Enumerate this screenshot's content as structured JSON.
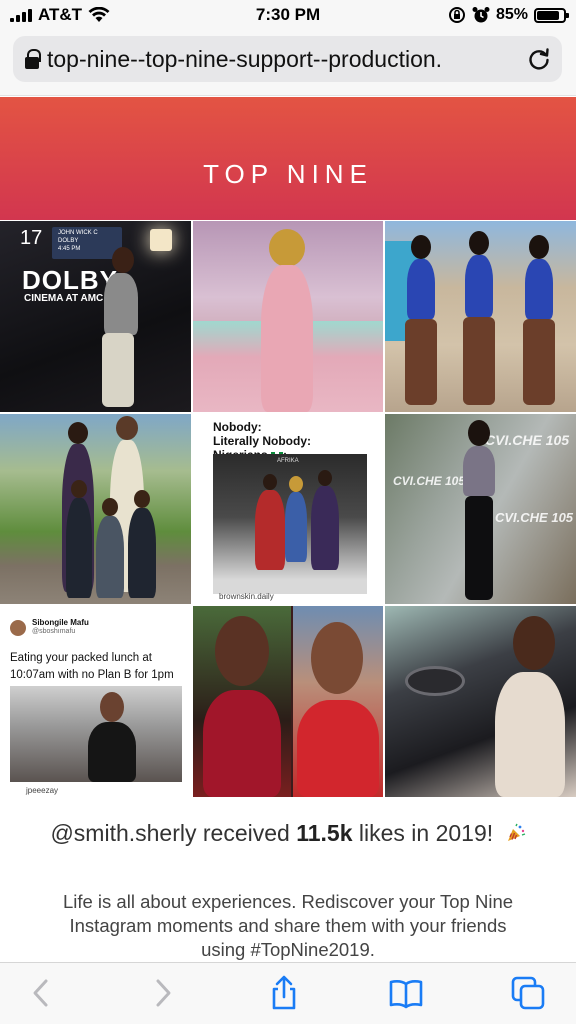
{
  "status_bar": {
    "carrier": "AT&T",
    "time": "7:30 PM",
    "battery_percent": "85%",
    "battery_level": 0.85,
    "icons": [
      "signal-icon",
      "wifi-icon",
      "orientation-lock-icon",
      "alarm-icon",
      "battery-icon"
    ]
  },
  "browser": {
    "url": "top-nine--top-nine-support--production.",
    "icons": [
      "lock-icon",
      "reload-icon"
    ]
  },
  "header": {
    "title": "TOP NINE",
    "colors": {
      "top": "#e35443",
      "bottom": "#d2364f"
    }
  },
  "grid": {
    "tile1": {
      "screen_number": "17",
      "marquee_line1": "JOHN WICK C",
      "marquee_line2": "DOLBY",
      "marquee_line3": "4:45 PM",
      "logo": "DOLBY",
      "logo_sub": "CINEMA AT AMC"
    },
    "tile5": {
      "line1": "Nobody:",
      "line2": "Literally Nobody:",
      "line3": "Nigerians",
      "image_caption": "AFRIKA",
      "credit": "brownskin.daily"
    },
    "tile6": {
      "sign_text": "CVI.CHE 105"
    },
    "tile7": {
      "name": "Sibongile Mafu",
      "handle": "@sboshımafu",
      "text": "Eating your packed lunch at 10:07am with no Plan B for 1pm",
      "credit": "jpeeezay"
    }
  },
  "summary": {
    "user": "@smith.sherly",
    "mid": "received",
    "likes": "11.5k",
    "tail": "likes in 2019!",
    "icon": "party-popper-icon"
  },
  "blurb": "Life is all about experiences. Rediscover your Top Nine Instagram moments and share them with your friends using #TopNine2019.",
  "toolbar": {
    "buttons": [
      "back-icon",
      "forward-icon",
      "share-icon",
      "bookmarks-icon",
      "tabs-icon"
    ],
    "accent": "#1a7cf5"
  }
}
